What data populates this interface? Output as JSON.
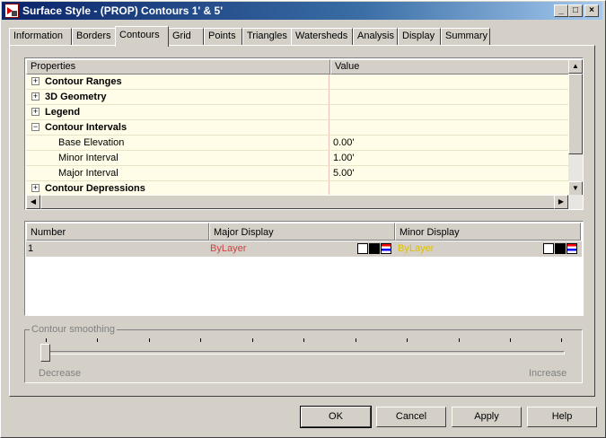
{
  "window": {
    "title": "Surface Style - (PROP) Contours 1' & 5'"
  },
  "titlebar": {
    "minimize": "_",
    "maximize": "□",
    "close": "×"
  },
  "tabs": [
    "Information",
    "Borders",
    "Contours",
    "Grid",
    "Points",
    "Triangles",
    "Watersheds",
    "Analysis",
    "Display",
    "Summary"
  ],
  "active_tab": "Contours",
  "properties": {
    "header": {
      "col1": "Properties",
      "col2": "Value"
    },
    "rows": [
      {
        "label": "Contour Ranges",
        "value": "",
        "type": "category",
        "expanded": false,
        "expander": "+"
      },
      {
        "label": "3D Geometry",
        "value": "",
        "type": "category",
        "expanded": false,
        "expander": "+"
      },
      {
        "label": "Legend",
        "value": "",
        "type": "category",
        "expanded": false,
        "expander": "+"
      },
      {
        "label": "Contour Intervals",
        "value": "",
        "type": "category",
        "expanded": true,
        "expander": "−"
      },
      {
        "label": "Base Elevation",
        "value": "0.00'",
        "type": "property"
      },
      {
        "label": "Minor Interval",
        "value": "1.00'",
        "type": "property"
      },
      {
        "label": "Major Interval",
        "value": "5.00'",
        "type": "property"
      },
      {
        "label": "Contour Depressions",
        "value": "",
        "type": "category",
        "expanded": false,
        "expander": "+"
      }
    ]
  },
  "display_table": {
    "headers": [
      "Number",
      "Major Display",
      "Minor Display"
    ],
    "rows": [
      {
        "number": "1",
        "major": "ByLayer",
        "minor": "ByLayer"
      }
    ],
    "colors": {
      "major": "#d04040",
      "minor": "#e0c000"
    }
  },
  "smoothing": {
    "label": "Contour smoothing",
    "min_label": "Decrease",
    "max_label": "Increase",
    "value": 0,
    "enabled": false
  },
  "buttons": {
    "ok": "OK",
    "cancel": "Cancel",
    "apply": "Apply",
    "help": "Help"
  },
  "scroll_glyphs": {
    "up": "▲",
    "down": "▼",
    "left": "◀",
    "right": "▶"
  }
}
